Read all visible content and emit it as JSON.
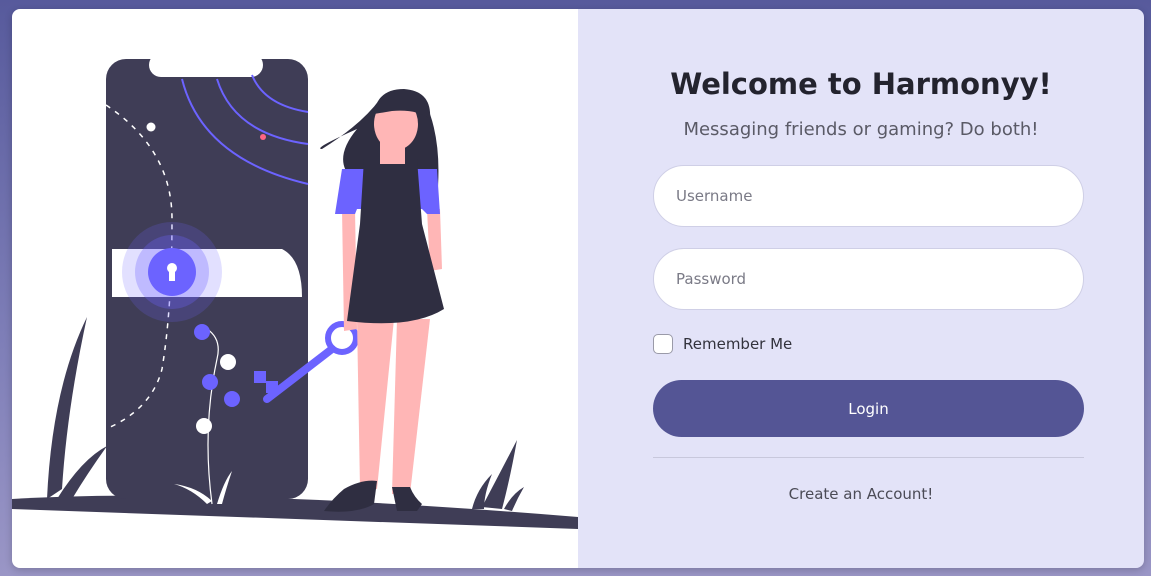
{
  "header": {
    "title": "Welcome to Harmonyy!",
    "subtitle": "Messaging friends or gaming? Do both!"
  },
  "form": {
    "username_placeholder": "Username",
    "password_placeholder": "Password",
    "remember_label": "Remember Me",
    "remember_checked": false,
    "login_label": "Login",
    "create_account_label": "Create an Account!"
  },
  "colors": {
    "accent": "#6c63ff",
    "button": "#545595",
    "panel": "#e3e3f8",
    "dark": "#3f3d56"
  },
  "illustration": {
    "name": "woman-with-key-unlocking-phone-illustration"
  }
}
